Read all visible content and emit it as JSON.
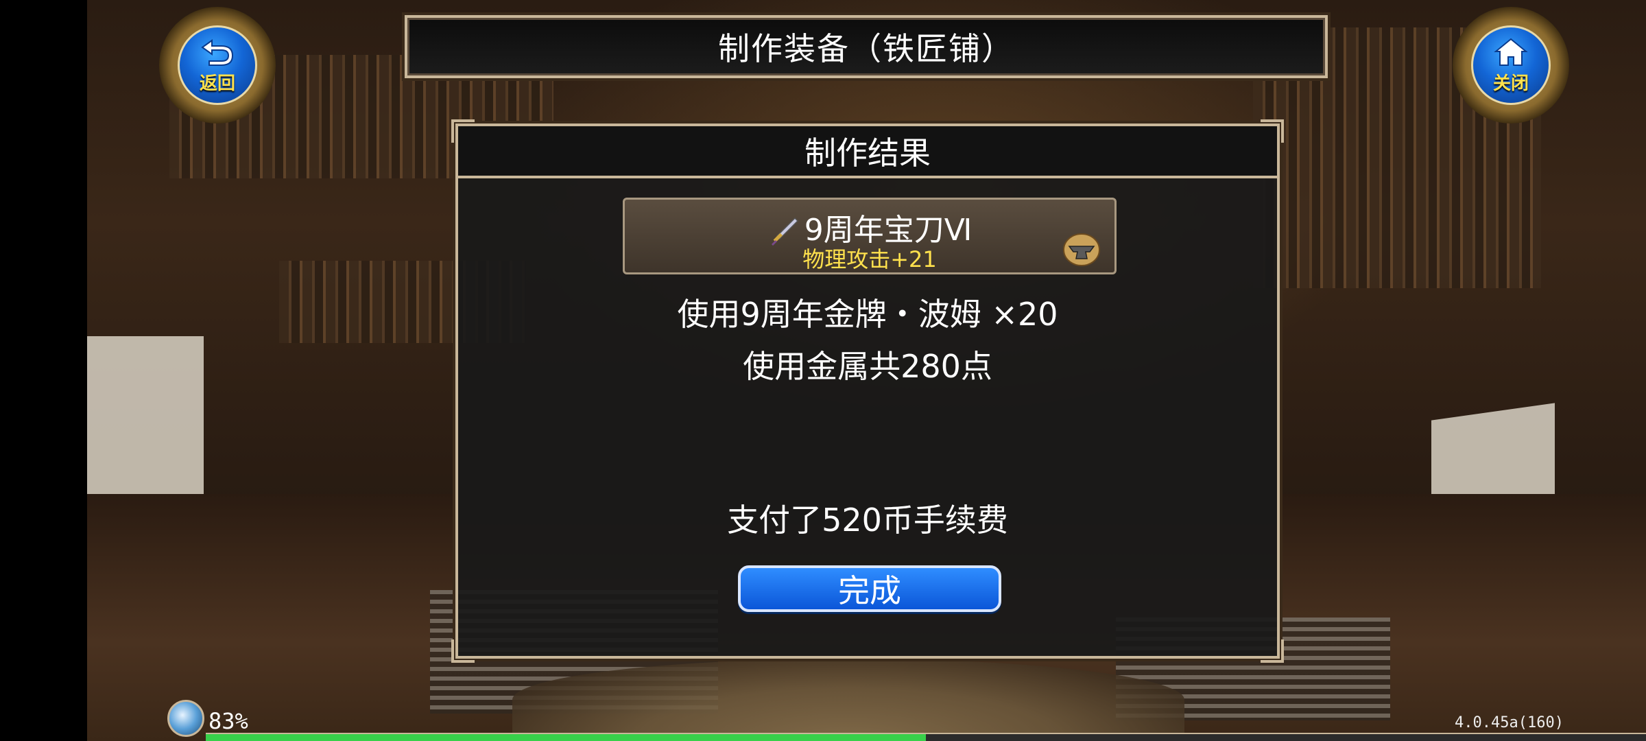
{
  "top_bar": {
    "title": "制作装备（铁匠铺）",
    "back_label": "返回",
    "close_label": "关闭"
  },
  "panel": {
    "header": "制作结果",
    "item": {
      "name": "9周年宝刀Ⅵ",
      "stat": "物理攻击+21"
    },
    "materials_line": "使用9周年金牌・波姆 ×20",
    "metal_line": "使用金属共280点",
    "fee_line": "支付了520币手续费",
    "done_label": "完成"
  },
  "status": {
    "percent": "83%",
    "version": "4.0.45a(160)",
    "progress_fraction": 0.5
  }
}
